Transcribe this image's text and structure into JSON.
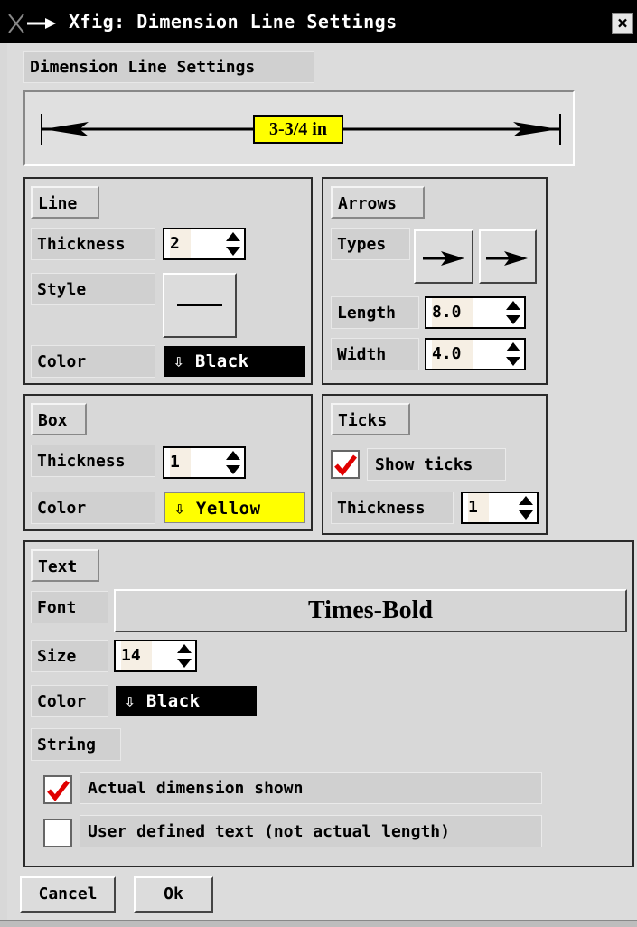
{
  "window": {
    "title": "Xfig: Dimension Line Settings",
    "close_glyph": "×"
  },
  "dialog_label": "Dimension Line Settings",
  "preview": {
    "text": "3-3/4 in"
  },
  "line": {
    "heading": "Line",
    "thickness_label": "Thickness",
    "thickness_value": "2",
    "style_label": "Style",
    "color_label": "Color",
    "color_value": "Black"
  },
  "arrows": {
    "heading": "Arrows",
    "types_label": "Types",
    "length_label": "Length",
    "length_value": "8.0",
    "width_label": "Width",
    "width_value": "4.0"
  },
  "box": {
    "heading": "Box",
    "thickness_label": "Thickness",
    "thickness_value": "1",
    "color_label": "Color",
    "color_value": "Yellow"
  },
  "ticks": {
    "heading": "Ticks",
    "show_label": "Show ticks",
    "show_checked": true,
    "thickness_label": "Thickness",
    "thickness_value": "1"
  },
  "text": {
    "heading": "Text",
    "font_label": "Font",
    "font_value": "Times-Bold",
    "size_label": "Size",
    "size_value": "14",
    "color_label": "Color",
    "color_value": "Black",
    "string_label": "String",
    "actual_label": "Actual dimension shown",
    "actual_checked": true,
    "user_label": "User defined text (not actual length)",
    "user_checked": false
  },
  "buttons": {
    "cancel": "Cancel",
    "ok": "Ok"
  },
  "colors": {
    "black_swatch": "#000000",
    "yellow_swatch": "#ffff00",
    "check_red": "#e00000"
  }
}
